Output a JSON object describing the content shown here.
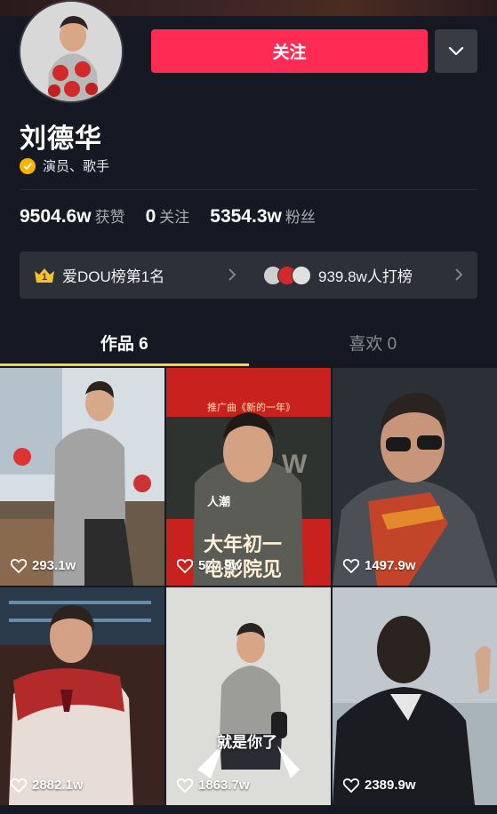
{
  "profile": {
    "name": "刘德华",
    "verification": "演员、歌手",
    "follow_label": "关注"
  },
  "stats": [
    {
      "value": "9504.6w",
      "label": "获赞"
    },
    {
      "value": "0",
      "label": "关注"
    },
    {
      "value": "5354.3w",
      "label": "粉丝"
    }
  ],
  "rank": {
    "badge": "1",
    "label": "爱DOU榜第1名",
    "fans_label": "939.8w人打榜"
  },
  "tabs": [
    {
      "label": "作品 6",
      "active": true
    },
    {
      "label": "喜欢 0",
      "active": false
    }
  ],
  "videos": [
    {
      "likes": "293.1w"
    },
    {
      "likes": "577.9w",
      "poster_top": "推广曲《新的一年》",
      "poster_main": "大年初一",
      "poster_sub": "电影院见",
      "caption": "人潮"
    },
    {
      "likes": "1497.9w"
    },
    {
      "likes": "2882.1w"
    },
    {
      "likes": "1863.7w",
      "caption": "就是你了"
    },
    {
      "likes": "2389.9w"
    }
  ],
  "colors": {
    "background": "#161823",
    "accent": "#fe2c55",
    "tab_underline": "#f7d640",
    "verify": "#f7b500"
  }
}
